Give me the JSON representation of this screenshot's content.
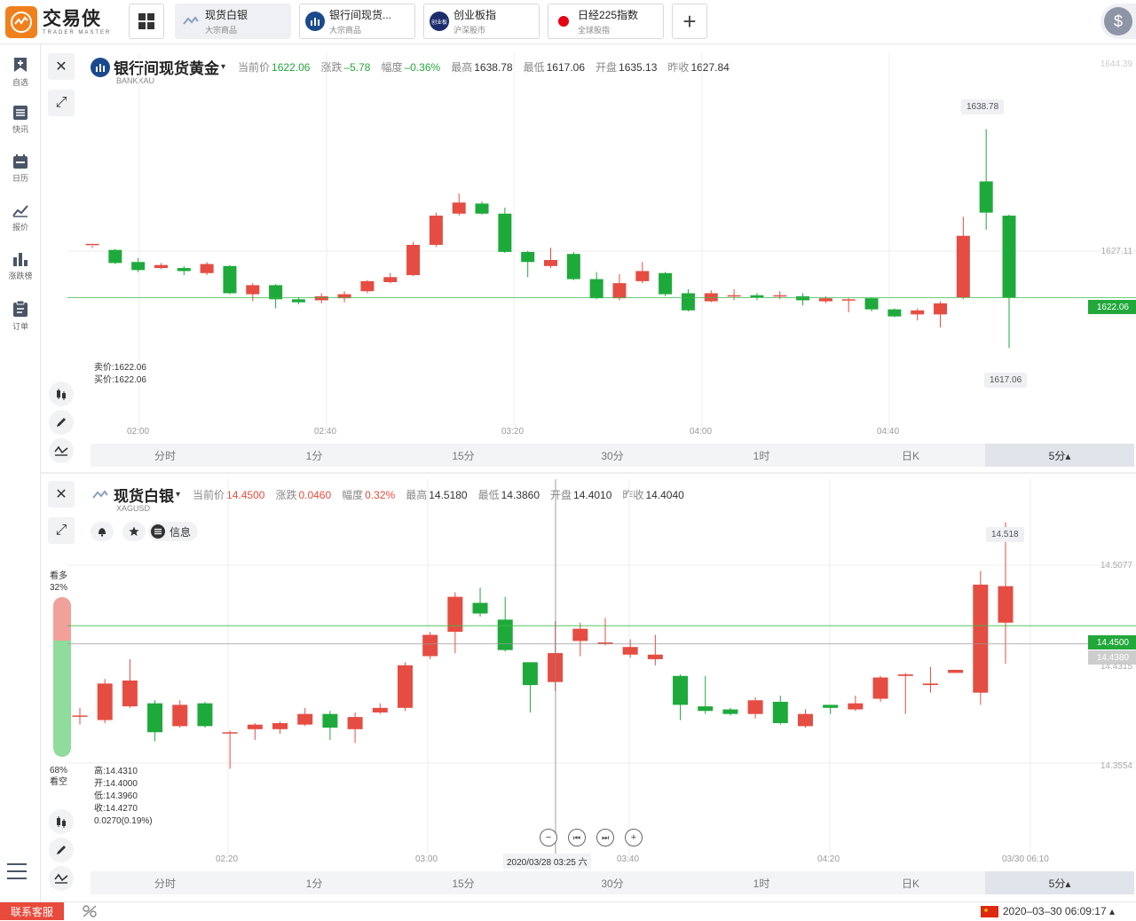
{
  "app": {
    "logo_cn": "交易侠",
    "logo_en": "TRADER MASTER"
  },
  "tabs": [
    {
      "name": "现货白银",
      "sub": "大宗商品"
    },
    {
      "name": "银行间现货...",
      "sub": "大宗商品"
    },
    {
      "name": "创业板指",
      "sub": "沪深股市"
    },
    {
      "name": "日经225指数",
      "sub": "全球股指"
    }
  ],
  "nav": [
    {
      "label": "自选"
    },
    {
      "label": "快讯"
    },
    {
      "label": "日历"
    },
    {
      "label": "报价"
    },
    {
      "label": "涨跌榜"
    },
    {
      "label": "订单"
    }
  ],
  "timeframes": [
    "分时",
    "1分",
    "15分",
    "30分",
    "1时",
    "日K",
    "5分▴"
  ],
  "chart1": {
    "name": "银行间现货黄金",
    "code": "BANKXAU",
    "quote": [
      {
        "k": "当前价",
        "v": "1622.06",
        "c": "g"
      },
      {
        "k": "涨跌",
        "v": "–5.78",
        "c": "g"
      },
      {
        "k": "幅度",
        "v": "–0.36%",
        "c": "g"
      },
      {
        "k": "最高",
        "v": "1638.78",
        "c": "k"
      },
      {
        "k": "最低",
        "v": "1617.06",
        "c": "k"
      },
      {
        "k": "开盘",
        "v": "1635.13",
        "c": "k"
      },
      {
        "k": "昨收",
        "v": "1627.84",
        "c": "k"
      }
    ],
    "sell": "卖价:1622.06",
    "buy": "买价:1622.06",
    "high_bubble": "1638.78",
    "low_bubble": "1617.06",
    "price_tag": "1622.06",
    "axis": [
      "1644.39",
      "1627.11"
    ],
    "xlabels": [
      "02:00",
      "02:40",
      "03:20",
      "04:00",
      "04:40"
    ],
    "ymin": 1614,
    "ymax": 1645,
    "candles": [
      [
        1627.4,
        1627.4,
        1627.0,
        1627.2
      ],
      [
        1626.8,
        1625.5,
        1626.9,
        1625.4
      ],
      [
        1625.6,
        1624.8,
        1626.0,
        1624.6
      ],
      [
        1625.0,
        1625.3,
        1625.5,
        1624.9
      ],
      [
        1625.0,
        1624.7,
        1625.2,
        1624.3
      ],
      [
        1624.5,
        1625.4,
        1625.6,
        1624.3
      ],
      [
        1625.2,
        1622.5,
        1625.3,
        1622.4
      ],
      [
        1622.4,
        1623.3,
        1623.5,
        1621.7
      ],
      [
        1623.3,
        1621.9,
        1623.4,
        1621.0
      ],
      [
        1621.9,
        1621.6,
        1622.1,
        1621.4
      ],
      [
        1621.8,
        1622.2,
        1622.5,
        1621.5
      ],
      [
        1622.0,
        1622.4,
        1622.7,
        1621.6
      ],
      [
        1622.7,
        1623.7,
        1623.8,
        1622.5
      ],
      [
        1623.6,
        1624.1,
        1624.5,
        1623.5
      ],
      [
        1624.3,
        1627.3,
        1627.6,
        1624.2
      ],
      [
        1627.3,
        1630.2,
        1630.5,
        1627.1
      ],
      [
        1630.4,
        1631.5,
        1632.4,
        1630.2
      ],
      [
        1631.4,
        1630.4,
        1631.6,
        1630.3
      ],
      [
        1630.4,
        1626.6,
        1631.0,
        1626.5
      ],
      [
        1626.6,
        1625.6,
        1626.7,
        1624.1
      ],
      [
        1625.2,
        1625.8,
        1627.0,
        1625.0
      ],
      [
        1626.4,
        1623.9,
        1626.6,
        1623.8
      ],
      [
        1623.9,
        1622.0,
        1624.6,
        1621.9
      ],
      [
        1622.0,
        1623.5,
        1624.4,
        1621.8
      ],
      [
        1623.7,
        1624.7,
        1625.6,
        1623.5
      ],
      [
        1624.5,
        1622.4,
        1624.6,
        1622.2
      ],
      [
        1622.5,
        1620.8,
        1622.9,
        1620.7
      ],
      [
        1621.7,
        1622.5,
        1622.8,
        1621.6
      ],
      [
        1622.2,
        1622.3,
        1622.9,
        1621.8
      ],
      [
        1622.3,
        1622.1,
        1622.5,
        1621.8
      ],
      [
        1622.2,
        1622.3,
        1622.7,
        1621.9
      ],
      [
        1622.2,
        1621.8,
        1622.5,
        1621.3
      ],
      [
        1621.7,
        1622.0,
        1622.2,
        1621.5
      ],
      [
        1621.8,
        1621.9,
        1622.0,
        1620.6
      ],
      [
        1622.0,
        1620.9,
        1622.1,
        1620.7
      ],
      [
        1620.9,
        1620.2,
        1621.0,
        1620.1
      ],
      [
        1620.4,
        1620.8,
        1621.0,
        1619.8
      ],
      [
        1620.4,
        1621.5,
        1621.7,
        1619.1
      ],
      [
        1622.1,
        1628.2,
        1630.1,
        1621.9
      ],
      [
        1633.6,
        1630.5,
        1638.78,
        1628.8
      ],
      [
        1630.2,
        1622.06,
        1630.3,
        1617.06
      ]
    ]
  },
  "chart2": {
    "name": "现货白银",
    "code": "XAGUSD",
    "quote": [
      {
        "k": "当前价",
        "v": "14.4500",
        "c": "r"
      },
      {
        "k": "涨跌",
        "v": "0.0460",
        "c": "r"
      },
      {
        "k": "幅度",
        "v": "0.32%",
        "c": "r"
      },
      {
        "k": "最高",
        "v": "14.5180",
        "c": "k"
      },
      {
        "k": "最低",
        "v": "14.3860",
        "c": "k"
      },
      {
        "k": "开盘",
        "v": "14.4010",
        "c": "k"
      },
      {
        "k": "昨收",
        "v": "14.4040",
        "c": "k"
      }
    ],
    "pill_info": "信息",
    "bull_label": "看多",
    "bull_pct": "32%",
    "bear_label": "看空",
    "bear_pct": "68%",
    "bull_ratio": 0.32,
    "ohlc": [
      "高:14.4310",
      "开:14.4000",
      "低:14.3960",
      "收:14.4270",
      "0.0270(0.19%)"
    ],
    "high_bubble": "14.518",
    "price_tag": "14.4500",
    "cursor_tag": "14.4380",
    "axis": [
      "14.5077",
      "14.4315",
      "14.3554"
    ],
    "xlabels": [
      "02:20",
      "03:00",
      "03:40",
      "04:20",
      "03/30 06:10"
    ],
    "cursor_time": "2020/03/28 03:25 六",
    "ymin": 14.33,
    "ymax": 14.53,
    "candles": [
      [
        14.391,
        14.391,
        14.396,
        14.385
      ],
      [
        14.388,
        14.412,
        14.415,
        14.386
      ],
      [
        14.397,
        14.414,
        14.428,
        14.396
      ],
      [
        14.399,
        14.38,
        14.401,
        14.374
      ],
      [
        14.384,
        14.398,
        14.401,
        14.383
      ],
      [
        14.399,
        14.384,
        14.4,
        14.383
      ],
      [
        14.38,
        14.38,
        14.381,
        14.356
      ],
      [
        14.382,
        14.385,
        14.386,
        14.375
      ],
      [
        14.382,
        14.386,
        14.387,
        14.379
      ],
      [
        14.385,
        14.392,
        14.396,
        14.384
      ],
      [
        14.392,
        14.383,
        14.394,
        14.375
      ],
      [
        14.382,
        14.39,
        14.393,
        14.373
      ],
      [
        14.393,
        14.396,
        14.399,
        14.392
      ],
      [
        14.396,
        14.424,
        14.426,
        14.394
      ],
      [
        14.43,
        14.444,
        14.446,
        14.428
      ],
      [
        14.446,
        14.469,
        14.472,
        14.432
      ],
      [
        14.465,
        14.458,
        14.475,
        14.456
      ],
      [
        14.454,
        14.434,
        14.469,
        14.433
      ],
      [
        14.426,
        14.411,
        14.426,
        14.393
      ],
      [
        14.413,
        14.432,
        14.453,
        14.407
      ],
      [
        14.44,
        14.448,
        14.452,
        14.43
      ],
      [
        14.438,
        14.439,
        14.455,
        14.437
      ],
      [
        14.431,
        14.436,
        14.441,
        14.429
      ],
      [
        14.428,
        14.431,
        14.444,
        14.424
      ],
      [
        14.417,
        14.398,
        14.418,
        14.388
      ],
      [
        14.397,
        14.394,
        14.417,
        14.392
      ],
      [
        14.395,
        14.392,
        14.396,
        14.391
      ],
      [
        14.392,
        14.401,
        14.403,
        14.389
      ],
      [
        14.4,
        14.386,
        14.404,
        14.385
      ],
      [
        14.384,
        14.392,
        14.395,
        14.383
      ],
      [
        14.398,
        14.396,
        14.398,
        14.392
      ],
      [
        14.395,
        14.399,
        14.404,
        14.394
      ],
      [
        14.402,
        14.416,
        14.417,
        14.4
      ],
      [
        14.417,
        14.418,
        14.419,
        14.392
      ],
      [
        14.411,
        14.412,
        14.423,
        14.406
      ],
      [
        14.419,
        14.421,
        14.421,
        14.419
      ],
      [
        14.406,
        14.477,
        14.486,
        14.398
      ],
      [
        14.452,
        14.476,
        14.518,
        14.425
      ]
    ]
  },
  "footer": {
    "service": "联系客服",
    "clock": "2020–03–30 06:09:17 ▴"
  },
  "colors": {
    "up": "#e54d42",
    "down": "#1eaa3b",
    "accent": "#f0801e"
  }
}
